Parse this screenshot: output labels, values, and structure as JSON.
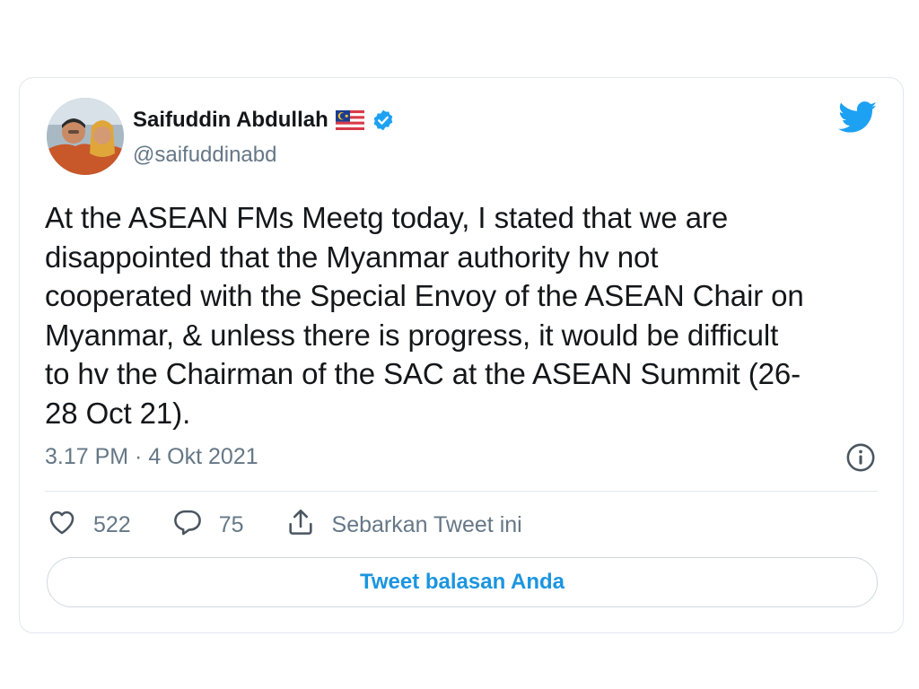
{
  "author": {
    "name": "Saifuddin Abdullah",
    "handle": "@saifuddinabd"
  },
  "icons": {
    "flag": "malaysia-flag-icon",
    "verified": "verified-badge-icon",
    "logo": "twitter-bird-icon",
    "info": "info-icon",
    "like": "heart-icon",
    "reply": "comment-icon",
    "share": "share-icon"
  },
  "colors": {
    "brand": "#1da1f2",
    "text": "#14171a",
    "muted": "#657786",
    "border": "#e1e8ed",
    "link": "#1b95e0"
  },
  "tweet": {
    "text": "At the ASEAN FMs Meetg today, I stated that we are\ndisappointed that the Myanmar authority hv not\ncooperated with the Special Envoy of the ASEAN Chair on\nMyanmar, & unless there is progress, it would be difficult\nto hv the Chairman of the SAC at the ASEAN Summit (26-\n28 Oct 21).",
    "timestamp": "3.17 PM · 4 Okt 2021"
  },
  "actions": {
    "likes": "522",
    "replies": "75",
    "share_label": "Sebarkan Tweet ini"
  },
  "reply_button": {
    "label": "Tweet balasan Anda"
  }
}
